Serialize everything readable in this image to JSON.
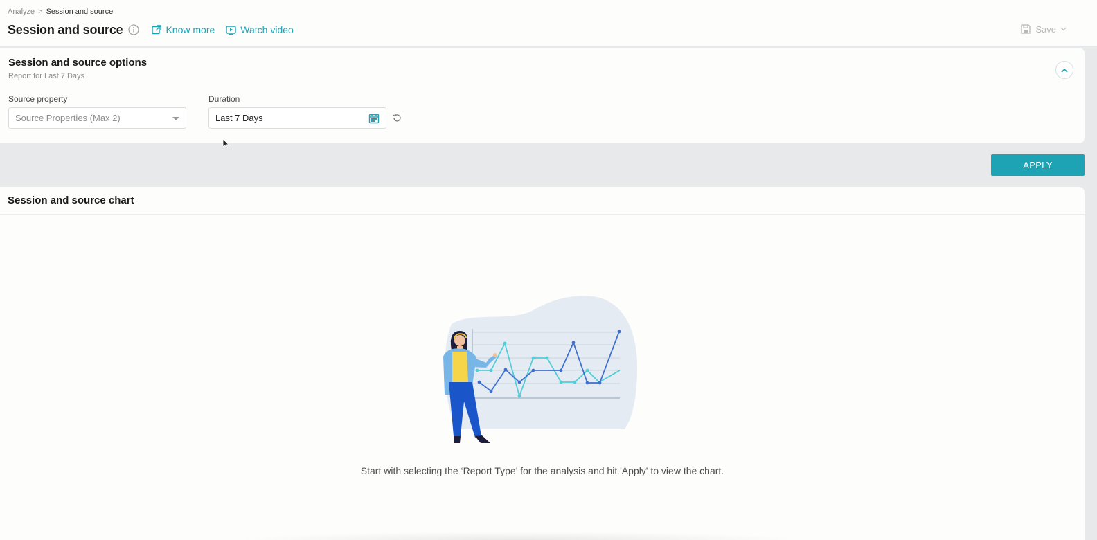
{
  "breadcrumb": {
    "parent": "Analyze",
    "separator": ">",
    "current": "Session and source"
  },
  "header": {
    "title": "Session and source",
    "know_more": "Know more",
    "watch_video": "Watch video",
    "save": "Save"
  },
  "options": {
    "title": "Session and source options",
    "subtitle": "Report for Last 7 Days",
    "source_label": "Source property",
    "source_placeholder": "Source Properties (Max 2)",
    "duration_label": "Duration",
    "duration_value": "Last 7 Days"
  },
  "apply_label": "APPLY",
  "chart": {
    "title": "Session and source chart",
    "empty_message": "Start with selecting the ‘Report Type’ for the analysis and hit 'Apply' to view the chart."
  },
  "colors": {
    "accent": "#1ea3b4",
    "line_dark": "#3f6fcf",
    "line_light": "#52cdd6"
  },
  "icons": [
    "info-icon",
    "external-link-icon",
    "video-icon",
    "save-icon",
    "chevron-down-icon",
    "chevron-up-icon",
    "calendar-icon",
    "reset-icon"
  ]
}
